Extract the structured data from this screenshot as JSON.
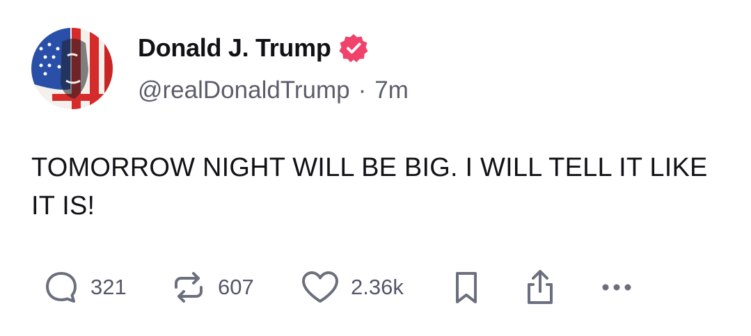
{
  "author": {
    "display_name": "Donald J. Trump",
    "handle": "@realDonaldTrump",
    "separator": "·",
    "time_ago": "7m",
    "verified": true,
    "verified_color": "#f0426a"
  },
  "post": {
    "text": "TOMORROW NIGHT WILL BE BIG. I WILL TELL IT LIKE IT IS!"
  },
  "actions": {
    "reply": {
      "icon": "reply-icon",
      "count": "321"
    },
    "repost": {
      "icon": "repost-icon",
      "count": "607"
    },
    "like": {
      "icon": "heart-icon",
      "count": "2.36k"
    },
    "bookmark": {
      "icon": "bookmark-icon"
    },
    "share": {
      "icon": "share-icon"
    },
    "more": {
      "icon": "more-icon"
    }
  },
  "colors": {
    "text_primary": "#111116",
    "text_secondary": "#5b5d6b",
    "icon": "#6b6e7d"
  }
}
